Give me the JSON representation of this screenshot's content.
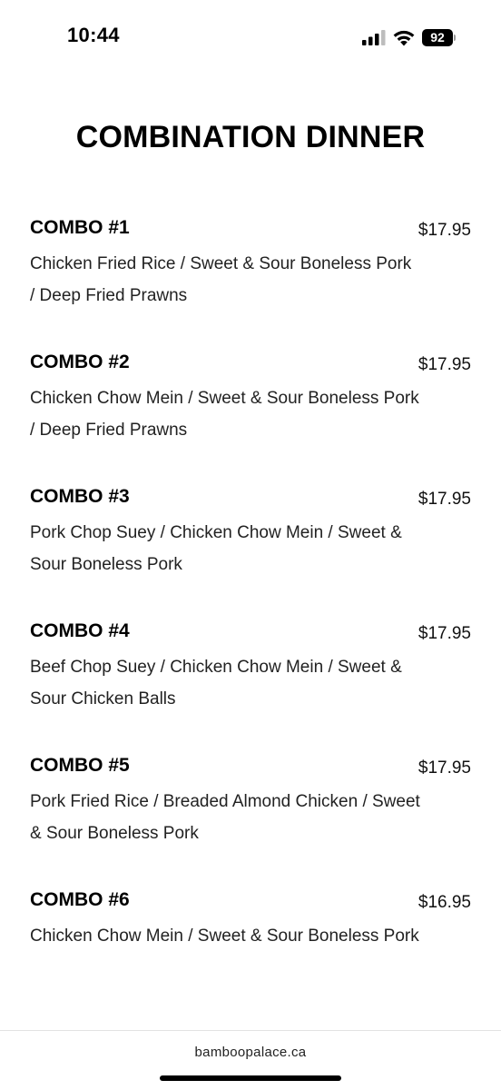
{
  "status_bar": {
    "time": "10:44",
    "battery_level": "92",
    "icons": [
      "signal-icon",
      "wifi-icon",
      "battery-icon"
    ]
  },
  "page": {
    "title": "COMBINATION DINNER"
  },
  "menu_items": [
    {
      "name": "COMBO #1",
      "price": "$17.95",
      "description": "Chicken Fried Rice / Sweet & Sour Boneless Pork / Deep Fried Prawns"
    },
    {
      "name": "COMBO #2",
      "price": "$17.95",
      "description": "Chicken Chow Mein / Sweet & Sour Boneless Pork / Deep Fried Prawns"
    },
    {
      "name": "COMBO #3",
      "price": "$17.95",
      "description": "Pork Chop Suey / Chicken Chow Mein / Sweet & Sour Boneless Pork"
    },
    {
      "name": "COMBO #4",
      "price": "$17.95",
      "description": "Beef Chop Suey / Chicken Chow Mein / Sweet & Sour Chicken Balls"
    },
    {
      "name": "COMBO #5",
      "price": "$17.95",
      "description": "Pork Fried Rice / Breaded Almond Chicken / Sweet & Sour Boneless Pork"
    },
    {
      "name": "COMBO #6",
      "price": "$16.95",
      "description": "Chicken Chow Mein / Sweet & Sour Boneless Pork"
    }
  ],
  "footer": {
    "url": "bamboopalace.ca"
  }
}
